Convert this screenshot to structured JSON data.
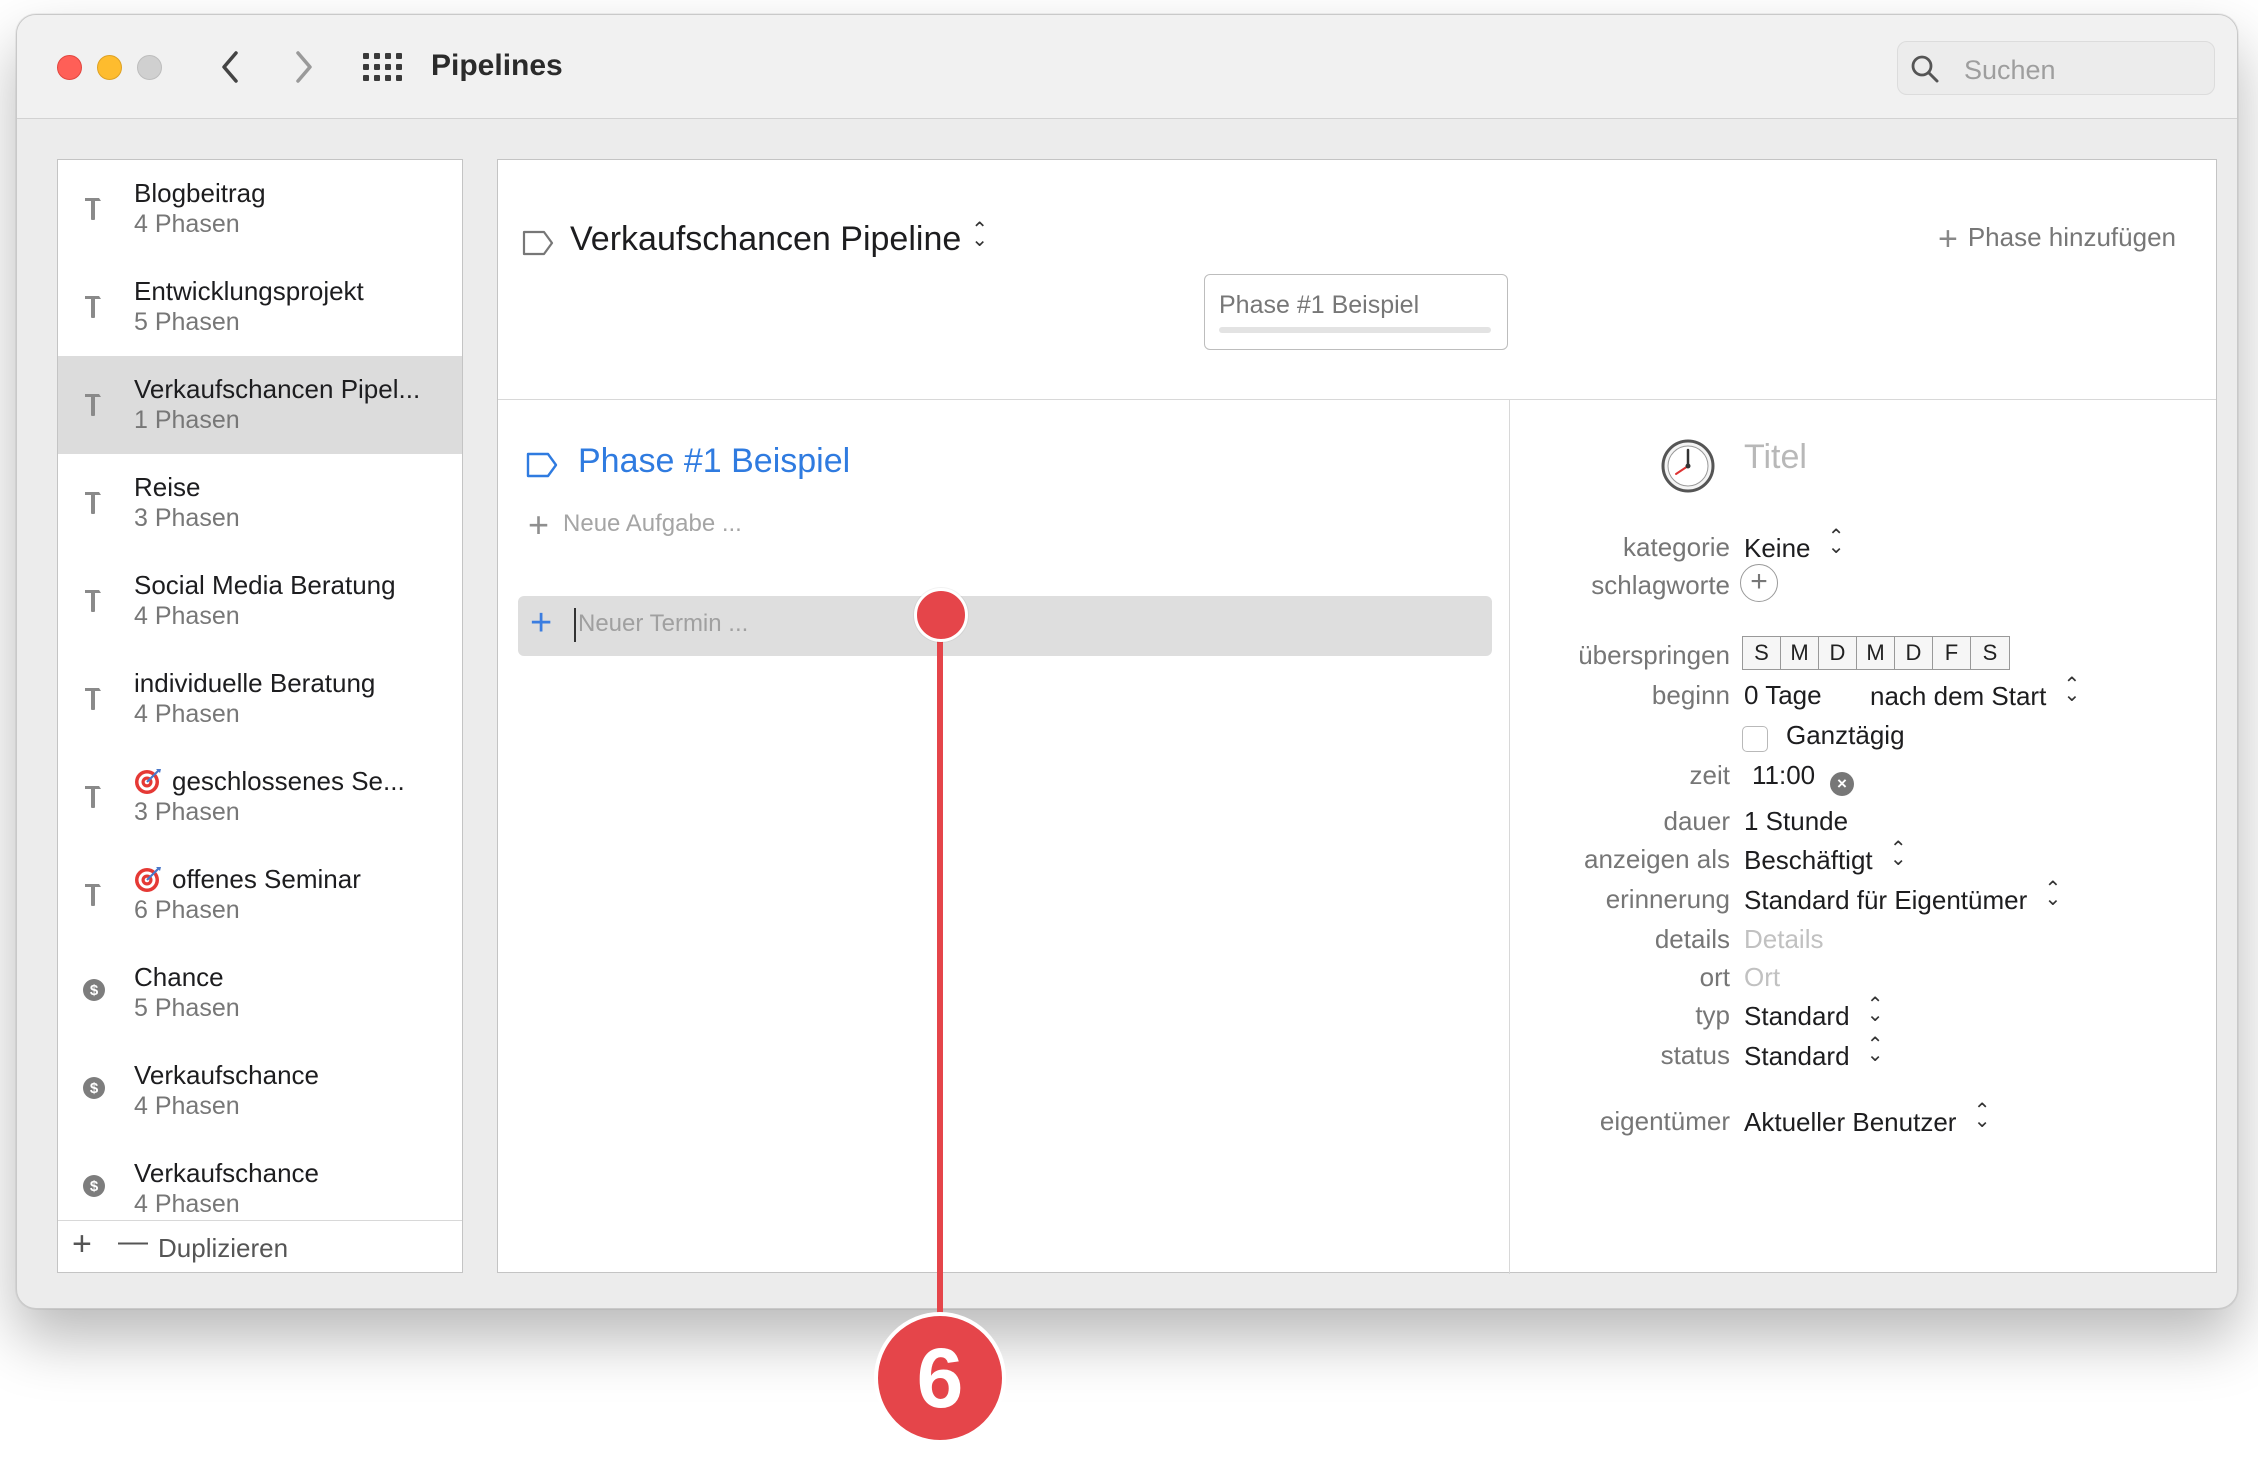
{
  "window": {
    "title": "Pipelines",
    "search_placeholder": "Suchen"
  },
  "sidebar": {
    "items": [
      {
        "name": "Blogbeitrag",
        "sub": "4 Phasen",
        "icon": "hammer-icon"
      },
      {
        "name": "Entwicklungsprojekt",
        "sub": "5 Phasen",
        "icon": "hammer-icon"
      },
      {
        "name": "Verkaufschancen Pipel...",
        "sub": "1 Phasen",
        "icon": "hammer-icon",
        "selected": true
      },
      {
        "name": "Reise",
        "sub": "3 Phasen",
        "icon": "hammer-icon"
      },
      {
        "name": "Social Media Beratung",
        "sub": "4 Phasen",
        "icon": "hammer-icon"
      },
      {
        "name": "individuelle Beratung",
        "sub": "4 Phasen",
        "icon": "hammer-icon"
      },
      {
        "name": "geschlossenes Se...",
        "sub": "3 Phasen",
        "icon": "hammer-icon",
        "emoji": "target-icon"
      },
      {
        "name": "offenes Seminar",
        "sub": "6 Phasen",
        "icon": "hammer-icon",
        "emoji": "target-icon"
      },
      {
        "name": "Chance",
        "sub": "5 Phasen",
        "icon": "dollar-icon"
      },
      {
        "name": "Verkaufschance",
        "sub": "4 Phasen",
        "icon": "dollar-icon"
      },
      {
        "name": "Verkaufschance",
        "sub": "4 Phasen",
        "icon": "dollar-icon"
      }
    ],
    "footer": {
      "add": "+",
      "remove": "—",
      "duplicate": "Duplizieren"
    }
  },
  "main": {
    "pipeline_title": "Verkaufschancen Pipeline",
    "add_phase": "Phase hinzufügen",
    "phase_chip": "Phase #1 Beispiel",
    "phase_heading": "Phase #1 Beispiel",
    "new_task_placeholder": "Neue Aufgabe ...",
    "new_event_placeholder": "Neuer Termin ..."
  },
  "detail": {
    "title_placeholder": "Titel",
    "fields": {
      "kategorie": {
        "label": "kategorie",
        "value": "Keine"
      },
      "schlagworte": {
        "label": "schlagworte"
      },
      "ueberspringen": {
        "label": "überspringen",
        "days": [
          "S",
          "M",
          "D",
          "M",
          "D",
          "F",
          "S"
        ]
      },
      "beginn": {
        "label": "beginn",
        "value": "0 Tage",
        "relative": "nach dem Start"
      },
      "ganztaegig": {
        "label": "Ganztägig",
        "checked": false
      },
      "zeit": {
        "label": "zeit",
        "value": "11:00"
      },
      "dauer": {
        "label": "dauer",
        "value": "1 Stunde"
      },
      "anzeigen_als": {
        "label": "anzeigen als",
        "value": "Beschäftigt"
      },
      "erinnerung": {
        "label": "erinnerung",
        "value": "Standard für Eigentümer"
      },
      "details": {
        "label": "details",
        "placeholder": "Details"
      },
      "ort": {
        "label": "ort",
        "placeholder": "Ort"
      },
      "typ": {
        "label": "typ",
        "value": "Standard"
      },
      "status": {
        "label": "status",
        "value": "Standard"
      },
      "eigentuemer": {
        "label": "eigentümer",
        "value": "Aktueller Benutzer"
      }
    }
  },
  "annotation": {
    "number": "6",
    "color": "#e5454a"
  },
  "colors": {
    "accent": "#2f7be0",
    "selected_row": "#dcdcdc"
  }
}
